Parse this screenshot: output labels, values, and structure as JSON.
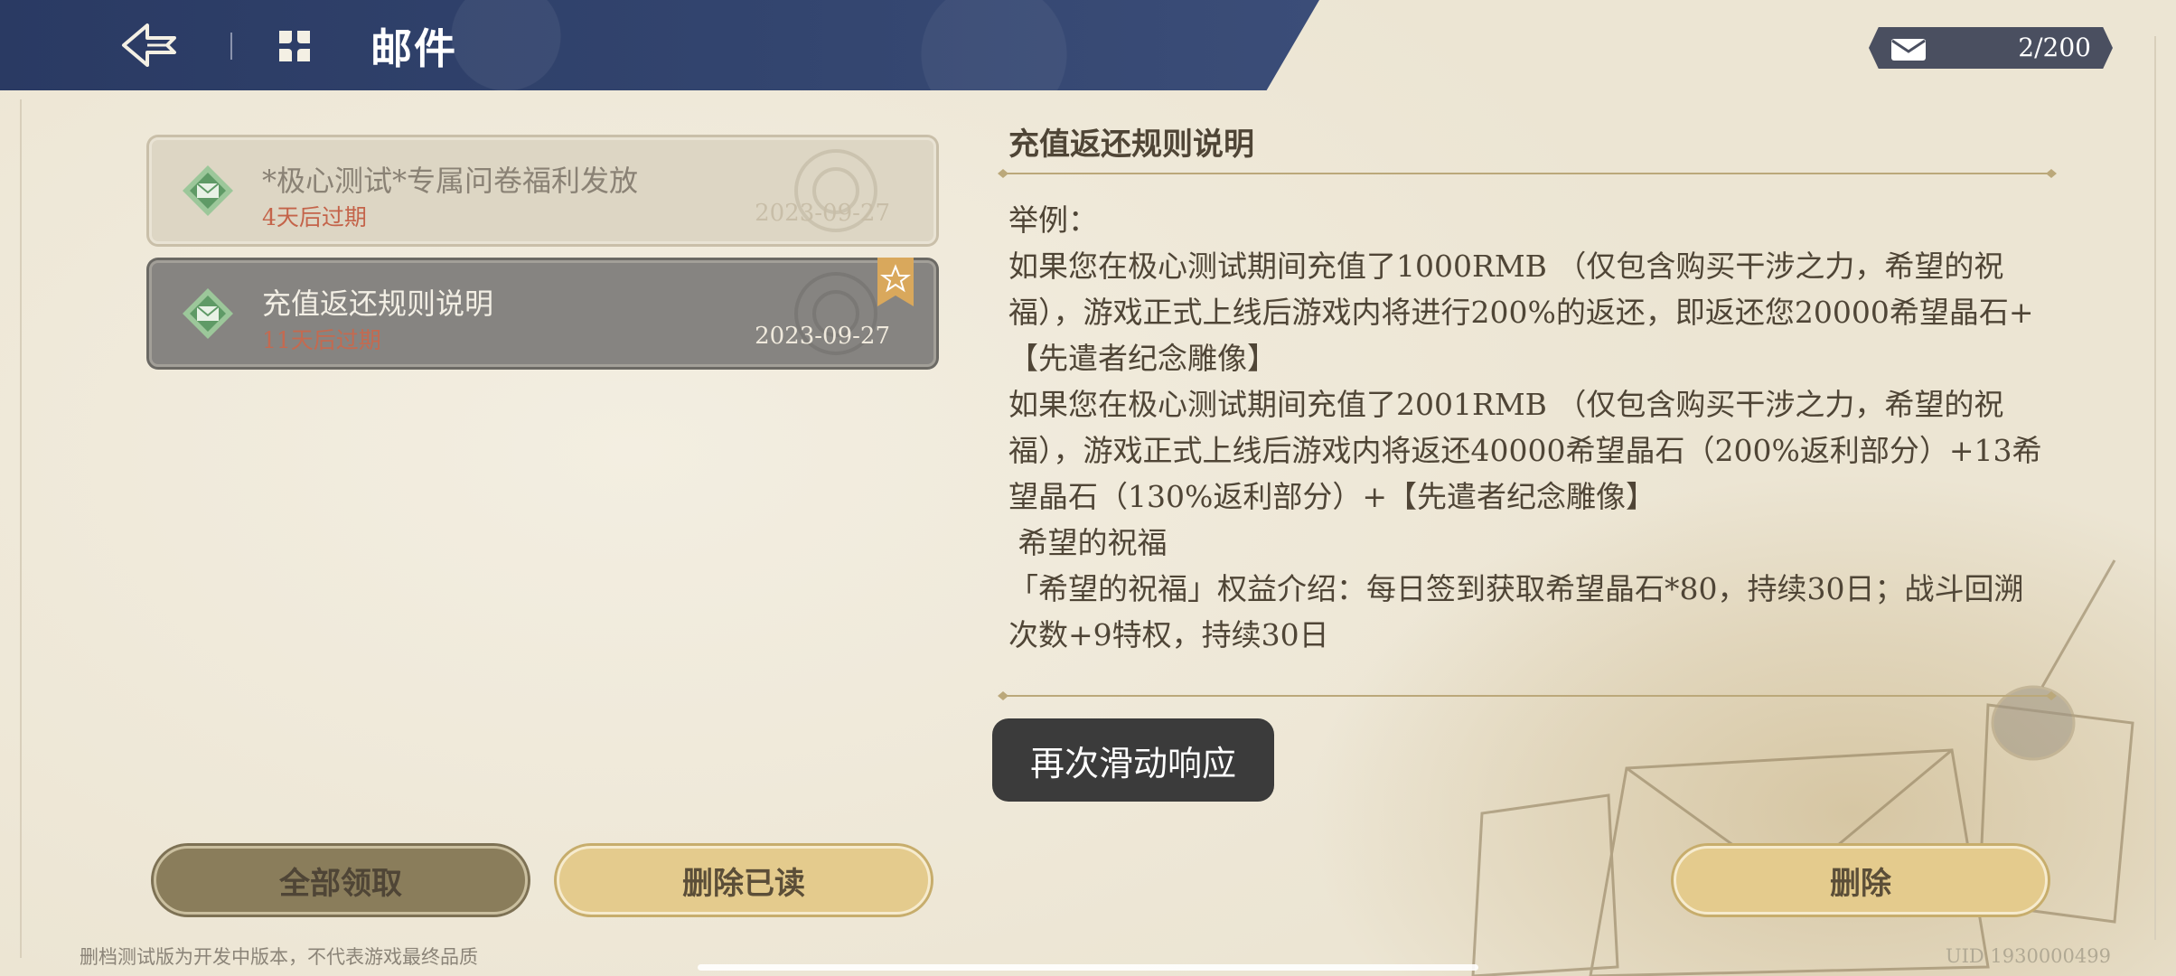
{
  "header": {
    "title": "邮件",
    "mail_count": "2/200"
  },
  "mails": [
    {
      "title": "*极心测试*专属问卷福利发放",
      "expire": "4天后过期",
      "date": "2023-09-27",
      "selected": false,
      "starred": false
    },
    {
      "title": "充值返还规则说明",
      "expire": "11天后过期",
      "date": "2023-09-27",
      "selected": true,
      "starred": true
    }
  ],
  "detail": {
    "title": "充值返还规则说明",
    "paragraphs": [
      "举例：",
      "如果您在极心测试期间充值了1000RMB （仅包含购买干涉之力，希望的祝福），游戏正式上线后游戏内将进行200%的返还，即返还您20000希望晶石+【先遣者纪念雕像】",
      "如果您在极心测试期间充值了2001RMB （仅包含购买干涉之力，希望的祝福），游戏正式上线后游戏内将返还40000希望晶石（200%返利部分）+13希望晶石（130%返利部分）+【先遣者纪念雕像】",
      "",
      " 希望的祝福",
      "「希望的祝福」权益介绍：每日签到获取希望晶石*80，持续30日；战斗回溯次数+9特权，持续30日"
    ]
  },
  "toast": "再次滑动响应",
  "buttons": {
    "claim_all": "全部领取",
    "delete_read": "删除已读",
    "delete": "删除"
  },
  "footer": {
    "note": "删档测试版为开发中版本，不代表游戏最终品质",
    "uid": "UID 1930000499"
  },
  "colors": {
    "header_bg": "#2a3a63",
    "selected_item_bg": "#868481",
    "gold_button": "#e4cb8d",
    "expire_red": "#c4644a"
  },
  "icons": [
    "back-arrow-icon",
    "mail-menu-icon",
    "envelope-icon",
    "gift-mail-icon",
    "star-bookmark-icon"
  ]
}
